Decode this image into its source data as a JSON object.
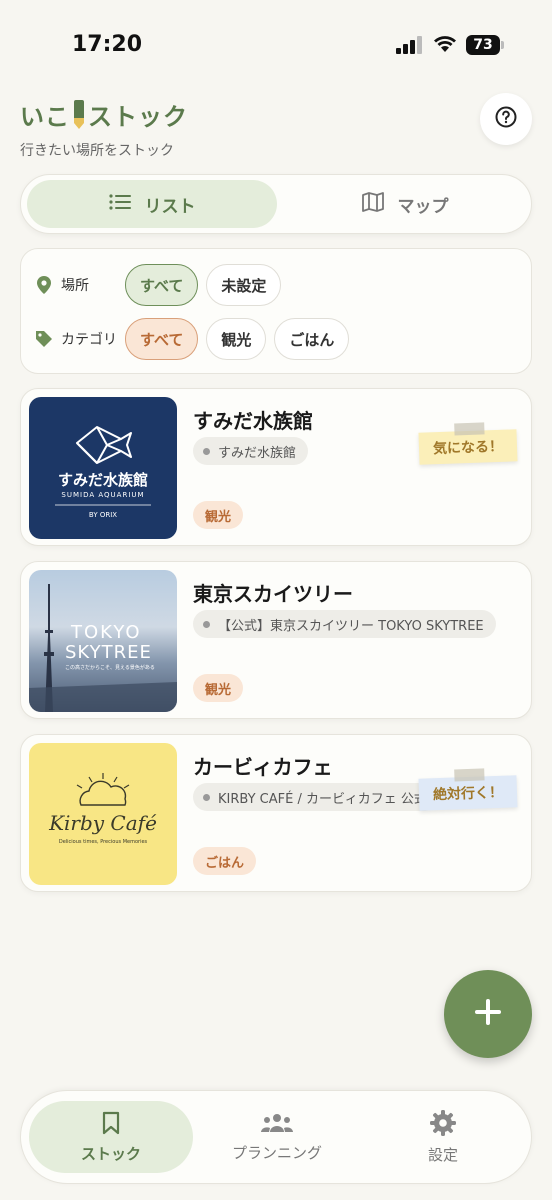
{
  "status_bar": {
    "time": "17:20",
    "battery": "73"
  },
  "header": {
    "logo_left": "いこ",
    "logo_right": "ストック",
    "subtitle": "行きたい場所をストック",
    "help_icon": "question-circle-icon"
  },
  "view_toggle": {
    "list_label": "リスト",
    "map_label": "マップ",
    "active": "list"
  },
  "filters": {
    "location": {
      "label": "場所",
      "options": [
        "すべて",
        "未設定"
      ],
      "selected": "すべて"
    },
    "category": {
      "label": "カテゴリ",
      "options": [
        "すべて",
        "観光",
        "ごはん"
      ],
      "selected": "すべて"
    }
  },
  "spots": [
    {
      "title": "すみだ水族館",
      "place": "すみだ水族館",
      "category": "観光",
      "tag": "気になる！",
      "tag_color": "#fbefb9",
      "thumb": {
        "line1": "すみだ水族館",
        "line2": "SUMIDA AQUARIUM",
        "line3": "BY ORIX",
        "bg": "#1c3766"
      }
    },
    {
      "title": "東京スカイツリー",
      "place": "【公式】東京スカイツリー TOKYO SKYTREE",
      "category": "観光",
      "tag": "",
      "thumb": {
        "line1": "TOKYO",
        "line2": "SKYTREE",
        "line3": "この高さだからこそ、見える景色がある"
      }
    },
    {
      "title": "カービィカフェ",
      "place": "KIRBY CAFÉ / カービィカフェ 公式",
      "category": "ごはん",
      "tag": "絶対行く！",
      "tag_color": "#dfe9f7",
      "thumb": {
        "line1": "Kirby Café",
        "line2": "Delicious times, Precious Memories",
        "bg": "#f8e685"
      }
    }
  ],
  "fab_icon": "plus-icon",
  "tab_bar": [
    {
      "label": "ストック",
      "icon": "bookmark-icon",
      "active": true
    },
    {
      "label": "プランニング",
      "icon": "people-icon",
      "active": false
    },
    {
      "label": "設定",
      "icon": "gear-icon",
      "active": false
    }
  ],
  "colors": {
    "primary": "#6f8f58",
    "primary_light": "#e4eddb",
    "accent_orange": "#b86a35",
    "background": "#f7f6f1"
  }
}
